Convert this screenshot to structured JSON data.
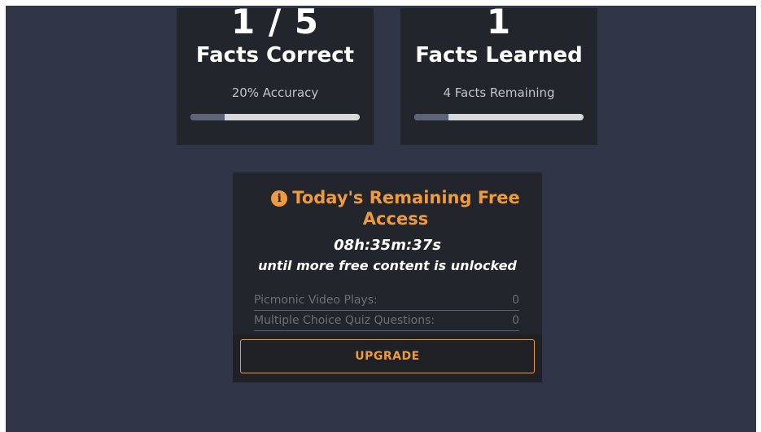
{
  "stats": {
    "correct": {
      "value": "1 / 5",
      "label": "Facts Correct",
      "sub": "20% Accuracy",
      "progress": 0.2
    },
    "learned": {
      "value": "1",
      "label": "Facts Learned",
      "sub": "4 Facts Remaining",
      "progress": 0.2
    }
  },
  "access": {
    "icon": "info-icon",
    "icon_glyph": "i",
    "title": "Today's Remaining Free Access",
    "timer": "08h:35m:37s",
    "unlock_text": "until more free content is unlocked",
    "limits": [
      {
        "label": "Picmonic Video Plays:",
        "value": "0"
      },
      {
        "label": "Multiple Choice Quiz Questions:",
        "value": "0"
      }
    ],
    "upgrade_label": "UPGRADE"
  },
  "colors": {
    "background": "#303548",
    "card": "#23252c",
    "accent": "#f09a3e",
    "progress_track": "#d8d9dc",
    "progress_fill": "#5d6478"
  }
}
